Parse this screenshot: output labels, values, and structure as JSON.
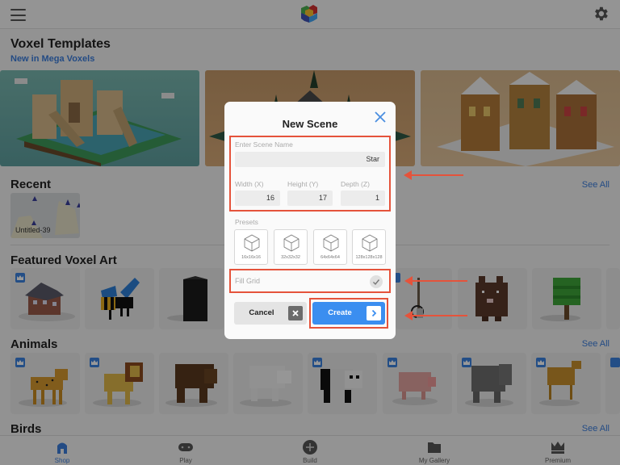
{
  "header": {
    "menu_icon": "hamburger-icon",
    "logo_icon": "mega-voxels-cube-logo",
    "settings_icon": "gear-icon"
  },
  "templates": {
    "title": "Voxel Templates",
    "subtitle": "New in Mega Voxels",
    "items": [
      {
        "name": "temple-ruins"
      },
      {
        "name": "forest-island"
      },
      {
        "name": "gingerbread-houses"
      }
    ]
  },
  "recent": {
    "title": "Recent",
    "see_all": "See All",
    "items": [
      {
        "label": "Untitled-39"
      }
    ]
  },
  "featured": {
    "title": "Featured Voxel Art",
    "items": [
      {
        "name": "house",
        "premium": true
      },
      {
        "name": "bee",
        "premium": false
      },
      {
        "name": "refrigerator",
        "premium": false
      },
      {
        "name": "banjo",
        "premium": true
      },
      {
        "name": "brown-monster",
        "premium": false
      },
      {
        "name": "tree",
        "premium": false
      }
    ]
  },
  "animals": {
    "title": "Animals",
    "see_all": "See All",
    "items": [
      {
        "name": "cheetah",
        "premium": true
      },
      {
        "name": "lion",
        "premium": true
      },
      {
        "name": "bear",
        "premium": false
      },
      {
        "name": "polar-bear",
        "premium": false
      },
      {
        "name": "panda",
        "premium": true
      },
      {
        "name": "pig",
        "premium": true
      },
      {
        "name": "elephant",
        "premium": true
      },
      {
        "name": "camel",
        "premium": true
      }
    ]
  },
  "birds": {
    "title": "Birds",
    "see_all": "See All"
  },
  "tabbar": {
    "tabs": [
      {
        "label": "Shop",
        "icon": "shop-icon",
        "active": true
      },
      {
        "label": "Play",
        "icon": "gamepad-icon",
        "active": false
      },
      {
        "label": "Build",
        "icon": "plus-circle-icon",
        "active": false
      },
      {
        "label": "My Gallery",
        "icon": "folder-icon",
        "active": false
      },
      {
        "label": "Premium",
        "icon": "crown-icon",
        "active": false
      }
    ]
  },
  "dialog": {
    "title": "New Scene",
    "close_icon": "close-icon",
    "name_label": "Enter Scene Name",
    "name_value": "Star",
    "width_label": "Width (X)",
    "width_value": "16",
    "height_label": "Height (Y)",
    "height_value": "17",
    "depth_label": "Depth (Z)",
    "depth_value": "1",
    "presets_label": "Presets",
    "presets": [
      {
        "label": "16x16x16"
      },
      {
        "label": "32x32x32"
      },
      {
        "label": "64x64x64"
      },
      {
        "label": "128x128x128"
      }
    ],
    "fill_grid_label": "Fill Grid",
    "fill_grid_checked": true,
    "cancel_label": "Cancel",
    "create_label": "Create"
  },
  "colors": {
    "accent": "#3b8ef0",
    "link": "#3b7ddd",
    "annotation": "#e5533b"
  }
}
